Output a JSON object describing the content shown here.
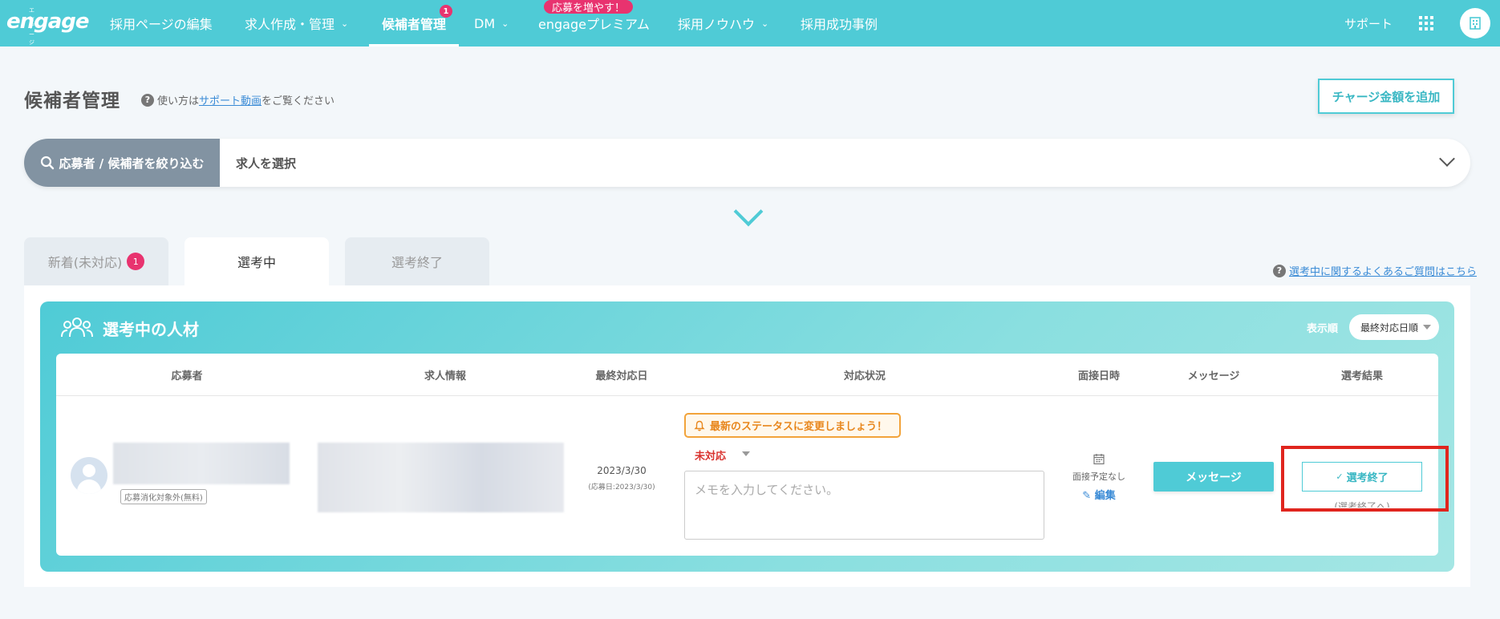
{
  "nav": {
    "logo_kana": "エンゲージ",
    "logo_word": "engage",
    "items": [
      {
        "label": "採用ページの編集"
      },
      {
        "label": "求人作成・管理"
      },
      {
        "label": "候補者管理",
        "badge": "1"
      },
      {
        "label": "DM"
      },
      {
        "label": "engageプレミアム"
      },
      {
        "label": "採用ノウハウ"
      },
      {
        "label": "採用成功事例"
      }
    ],
    "premium_badge": "応募を増やす！",
    "support": "サポート",
    "icons": [
      "chevron-down-icon",
      "grid-menu-icon",
      "building-icon"
    ]
  },
  "header": {
    "title": "候補者管理",
    "help_prefix": "使い方は",
    "help_link": "サポート動画",
    "help_suffix": "をご覧ください",
    "charge_button": "チャージ金額を追加"
  },
  "filter": {
    "button": "応募者 / 候補者を絞り込む",
    "job_select": "求人を選択"
  },
  "tabs": [
    {
      "label": "新着(未対応)",
      "badge": "1"
    },
    {
      "label": "選考中"
    },
    {
      "label": "選考終了"
    }
  ],
  "faq": "選考中に関するよくあるご質問はこちら",
  "panel": {
    "title": "選考中の人材",
    "sort_label": "表示順",
    "sort_value": "最終対応日順"
  },
  "table": {
    "headers": [
      "応募者",
      "求人情報",
      "最終対応日",
      "対応状況",
      "面接日時",
      "メッセージ",
      "選考結果"
    ],
    "rows": [
      {
        "tag": "応募消化対象外(無料)",
        "last_date": "2023/3/30",
        "applied_date": "(応募日:2023/3/30)",
        "alert": "最新のステータスに変更しましょう！",
        "status": "未対応",
        "memo_placeholder": "メモを入力してください。",
        "interview": "面接予定なし",
        "edit": "編集",
        "message_button": "メッセージ",
        "result_button": "選考終了",
        "result_sub": "(選考終了へ)"
      }
    ]
  },
  "colors": {
    "brand": "#4fcbd6",
    "badge": "#e8336f",
    "alert": "#f2a33a",
    "status_red": "#d9322e",
    "highlight": "#e0251e"
  }
}
